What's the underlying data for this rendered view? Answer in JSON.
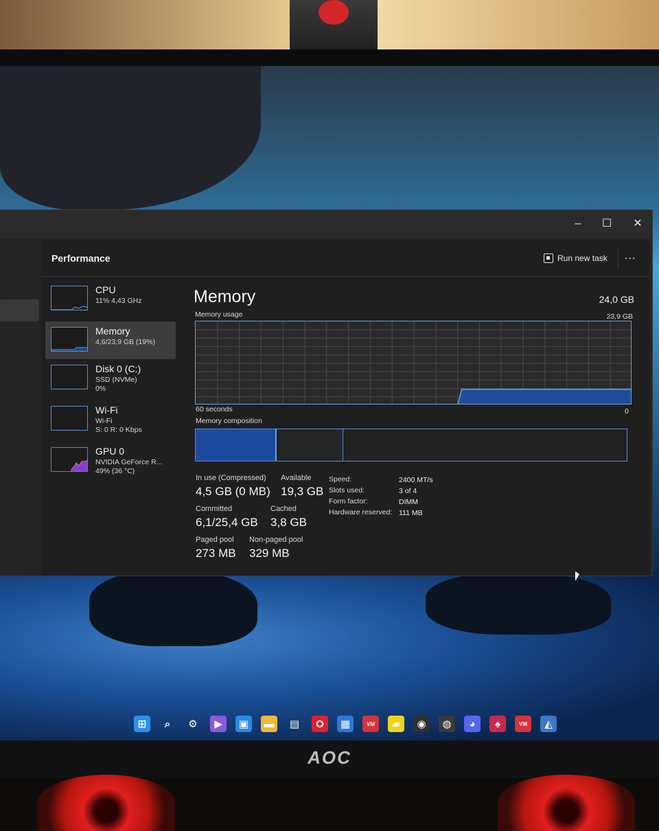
{
  "window": {
    "page_title": "Performance",
    "run_new_task_label": "Run new task",
    "more_label": "...",
    "controls": {
      "minimize": "–",
      "maximize": "☐",
      "close": "✕"
    }
  },
  "sidebar": {
    "items": [
      {
        "name": "CPU",
        "sub1": "11% 4,43 GHz",
        "sub2": ""
      },
      {
        "name": "Memory",
        "sub1": "4,6/23,9 GB (19%)",
        "sub2": ""
      },
      {
        "name": "Disk 0 (C:)",
        "sub1": "SSD (NVMe)",
        "sub2": "0%"
      },
      {
        "name": "Wi-Fi",
        "sub1": "Wi-Fi",
        "sub2": "S: 0 R: 0 Kbps"
      },
      {
        "name": "GPU 0",
        "sub1": "NVIDIA GeForce R...",
        "sub2": "49% (36 °C)"
      }
    ]
  },
  "memory": {
    "title": "Memory",
    "total": "24,0 GB",
    "usage_label": "Memory usage",
    "usage_max": "23,9 GB",
    "axis_left": "60 seconds",
    "axis_right": "0",
    "composition_label": "Memory composition",
    "usage_fraction": 0.19
  },
  "stats": {
    "in_use_label": "In use (Compressed)",
    "in_use_value": "4,5 GB (0 MB)",
    "available_label": "Available",
    "available_value": "19,3 GB",
    "committed_label": "Committed",
    "committed_value": "6,1/25,4 GB",
    "cached_label": "Cached",
    "cached_value": "3,8 GB",
    "paged_label": "Paged pool",
    "paged_value": "273 MB",
    "nonpaged_label": "Non-paged pool",
    "nonpaged_value": "329 MB"
  },
  "specs": [
    {
      "label": "Speed:",
      "value": "2400 MT/s"
    },
    {
      "label": "Slots used:",
      "value": "3 of 4"
    },
    {
      "label": "Form factor:",
      "value": "DIMM"
    },
    {
      "label": "Hardware reserved:",
      "value": "111 MB"
    }
  ],
  "monitor": {
    "brand": "AOC"
  },
  "taskbar": {
    "icons": [
      {
        "name": "start-icon",
        "glyph": "⊞",
        "color": "#2f8ff0"
      },
      {
        "name": "search-icon",
        "glyph": "⌕",
        "color": "transparent"
      },
      {
        "name": "settings-gear-icon",
        "glyph": "⚙",
        "color": "transparent"
      },
      {
        "name": "video-editor-icon",
        "glyph": "▶",
        "color": "#8a5ad8"
      },
      {
        "name": "task-view-icon",
        "glyph": "▣",
        "color": "#2a8ae0"
      },
      {
        "name": "file-explorer-icon",
        "glyph": "▬",
        "color": "#f0b83a"
      },
      {
        "name": "reader-icon",
        "glyph": "▤",
        "color": "transparent"
      },
      {
        "name": "opera-icon",
        "glyph": "O",
        "color": "#e0202e"
      },
      {
        "name": "store-app-icon",
        "glyph": "▦",
        "color": "#2a7ad8"
      },
      {
        "name": "voicemeeter-icon",
        "glyph": "VM",
        "color": "#d8323a"
      },
      {
        "name": "sticky-notes-icon",
        "glyph": "▰",
        "color": "#f2d21a"
      },
      {
        "name": "obs-icon",
        "glyph": "◉",
        "color": "#303030"
      },
      {
        "name": "davinci-icon",
        "glyph": "◍",
        "color": "#3a3a3a"
      },
      {
        "name": "discord-icon",
        "glyph": "◕",
        "color": "#5865f2"
      },
      {
        "name": "fox-app-icon",
        "glyph": "♠",
        "color": "#c82a4a"
      },
      {
        "name": "voicemeeter-2-icon",
        "glyph": "VM",
        "color": "#d8323a"
      },
      {
        "name": "task-manager-icon",
        "glyph": "◭",
        "color": "#3a78c8"
      }
    ]
  }
}
